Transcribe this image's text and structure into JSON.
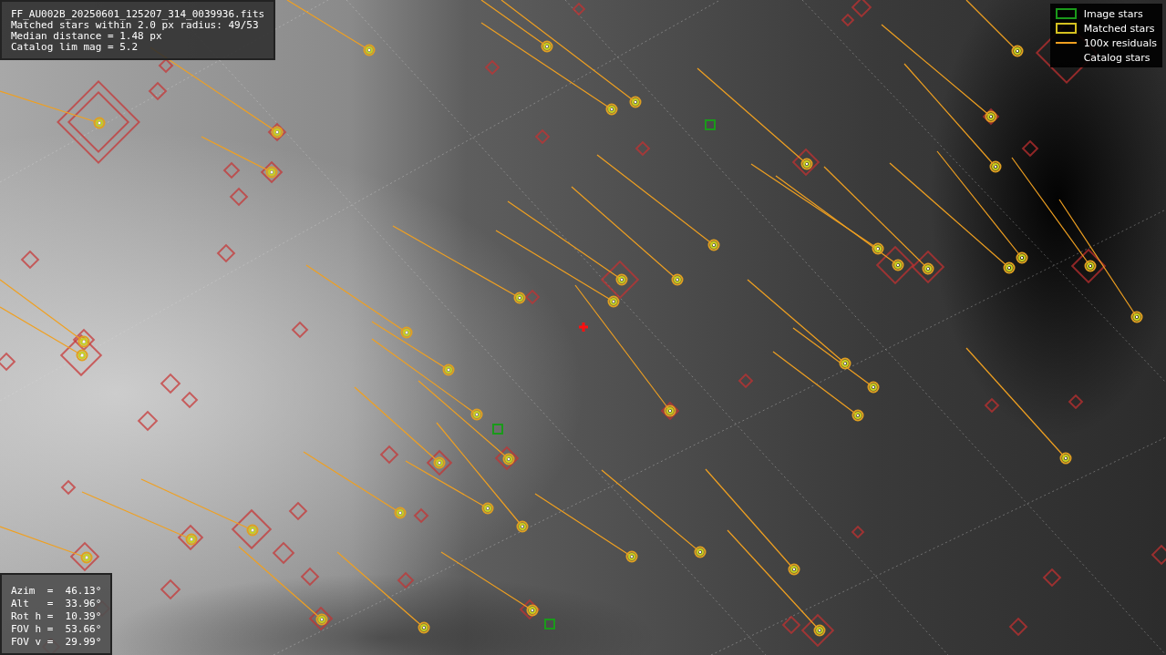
{
  "info_box": {
    "lines": [
      "FF_AU002B_20250601_125207_314_0039936.fits",
      "Matched stars within 2.0 px radius: 49/53",
      "Median distance = 1.48 px",
      "Catalog lim mag = 5.2"
    ]
  },
  "legend": [
    {
      "label": "Image stars"
    },
    {
      "kind": "matched",
      "label": "Matched stars"
    },
    {
      "kind": "residual",
      "label": "100x residuals"
    },
    {
      "kind": "catalog",
      "label": "Catalog stars"
    }
  ],
  "pointing_box": {
    "lines": [
      "Azim  =  46.13°",
      "Alt   =  33.96°",
      "Rot h =  10.39°",
      "FOV h =  53.66°",
      "FOV v =  29.99°"
    ]
  }
}
